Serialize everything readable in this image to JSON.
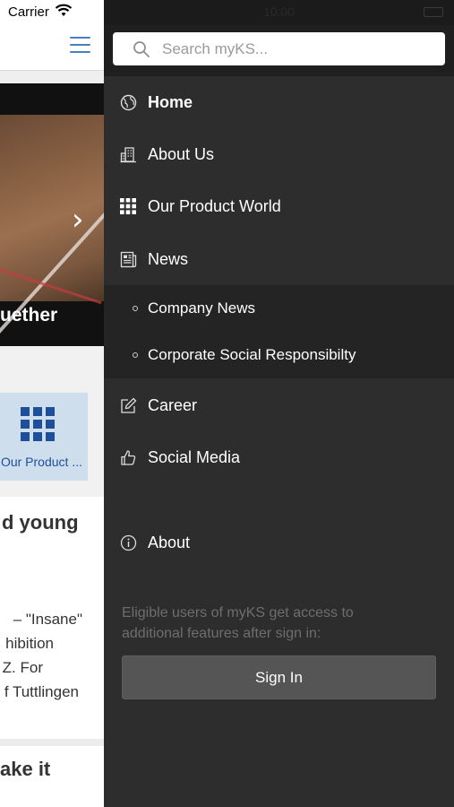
{
  "status_bar": {
    "carrier": "Carrier",
    "time": "10:00"
  },
  "background_page": {
    "hero_caption": "uether",
    "tile_label": "Our Product ...",
    "article_heading": "d young",
    "article_lines": [
      "– \"Insane\"",
      "hibition",
      "Z. For",
      "f Tuttlingen"
    ],
    "next_heading": "ake it"
  },
  "drawer": {
    "search": {
      "placeholder": "Search myKS..."
    },
    "nav": [
      {
        "label": "Home",
        "icon": "globe-icon",
        "active": true
      },
      {
        "label": "About Us",
        "icon": "building-icon"
      },
      {
        "label": "Our Product World",
        "icon": "grid-icon"
      },
      {
        "label": "News",
        "icon": "newspaper-icon"
      }
    ],
    "news_subitems": [
      {
        "label": "Company News"
      },
      {
        "label": "Corporate Social Responsibilty"
      }
    ],
    "nav_more": [
      {
        "label": "Career",
        "icon": "edit-icon"
      },
      {
        "label": "Social Media",
        "icon": "thumbs-up-icon"
      }
    ],
    "about": {
      "label": "About",
      "icon": "info-icon"
    },
    "signin_info": "Eligible users of myKS get access to additional features after sign in:",
    "signin_button": "Sign In"
  },
  "colors": {
    "drawer_bg": "#2d2d2d",
    "accent_blue": "#4a7fc1",
    "tile_blue": "#1d4f9a"
  }
}
